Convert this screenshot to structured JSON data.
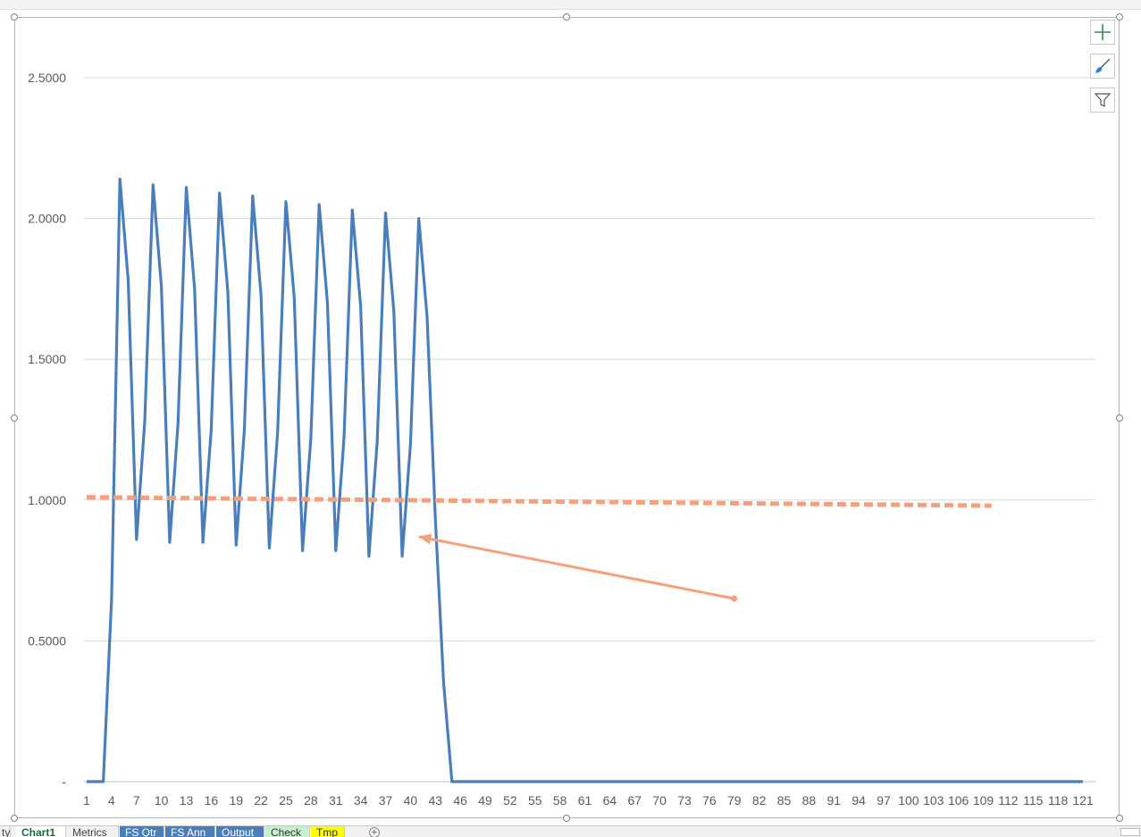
{
  "colors": {
    "series_main": "#4a7ebb",
    "arrow": "#f4a07c",
    "gridline": "#d9d9d9",
    "axis_text": "#595959"
  },
  "chart_tools": [
    {
      "name": "chart-elements-icon"
    },
    {
      "name": "chart-styles-brush-icon"
    },
    {
      "name": "chart-filters-funnel-icon"
    }
  ],
  "sheet_tabs": [
    {
      "label": "ty",
      "bg": "#f0f0f0",
      "color": "#444444"
    },
    {
      "label": "Chart1",
      "bg": "#ffffff",
      "color": "#1d6b3a",
      "active": true
    },
    {
      "label": "Metrics",
      "bg": "#f0f0f0",
      "color": "#444444"
    },
    {
      "label": "FS Qtr",
      "bg": "#4a7ebb",
      "color": "#ffffff"
    },
    {
      "label": "FS Ann",
      "bg": "#4a7ebb",
      "color": "#ffffff"
    },
    {
      "label": "Output",
      "bg": "#4a7ebb",
      "color": "#ffffff"
    },
    {
      "label": "Check",
      "bg": "#c6efce",
      "color": "#333333"
    },
    {
      "label": "Tmp",
      "bg": "#ffff00",
      "color": "#333333"
    }
  ],
  "chart_data": {
    "type": "line",
    "title": "",
    "xlabel": "",
    "ylabel": "",
    "ylim": [
      0,
      2.5
    ],
    "xlim": [
      1,
      121
    ],
    "y_ticks": [
      {
        "value": 0,
        "label": "-"
      },
      {
        "value": 0.5,
        "label": "0.5000"
      },
      {
        "value": 1.0,
        "label": "1.0000"
      },
      {
        "value": 1.5,
        "label": "1.5000"
      },
      {
        "value": 2.0,
        "label": "2.0000"
      },
      {
        "value": 2.5,
        "label": "2.5000"
      }
    ],
    "x_tick_labels": [
      "1",
      "4",
      "7",
      "10",
      "13",
      "16",
      "19",
      "22",
      "25",
      "28",
      "31",
      "34",
      "37",
      "40",
      "43",
      "46",
      "49",
      "52",
      "55",
      "58",
      "61",
      "64",
      "67",
      "70",
      "73",
      "76",
      "79",
      "82",
      "85",
      "88",
      "91",
      "94",
      "97",
      "100",
      "103",
      "106",
      "109",
      "112",
      "115",
      "118",
      "121"
    ],
    "grid": true,
    "legend": "none",
    "series": [
      {
        "style": "solid",
        "color": "#4a7ebb",
        "x": [
          1,
          2,
          3,
          4,
          5,
          6,
          7,
          8,
          9,
          10,
          11,
          12,
          13,
          14,
          15,
          16,
          17,
          18,
          19,
          20,
          21,
          22,
          23,
          24,
          25,
          26,
          27,
          28,
          29,
          30,
          31,
          32,
          33,
          34,
          35,
          36,
          37,
          38,
          39,
          40,
          41,
          42,
          43,
          44,
          45,
          121
        ],
        "y": [
          0,
          0,
          0,
          0.65,
          2.14,
          1.78,
          0.86,
          1.28,
          2.12,
          1.76,
          0.85,
          1.27,
          2.11,
          1.75,
          0.85,
          1.25,
          2.09,
          1.74,
          0.84,
          1.25,
          2.08,
          1.73,
          0.83,
          1.24,
          2.06,
          1.72,
          0.82,
          1.22,
          2.05,
          1.7,
          0.82,
          1.22,
          2.03,
          1.69,
          0.8,
          1.21,
          2.02,
          1.67,
          0.8,
          1.2,
          2.0,
          1.65,
          0.93,
          0.35,
          0,
          0
        ]
      },
      {
        "style": "dashed",
        "color": "#f4a07c",
        "x": [
          1,
          110
        ],
        "y": [
          1.01,
          0.98
        ]
      }
    ],
    "annotations": [
      {
        "type": "arrow",
        "from": [
          79,
          0.65
        ],
        "to": [
          41,
          0.87
        ],
        "color": "#f4a07c"
      }
    ]
  }
}
